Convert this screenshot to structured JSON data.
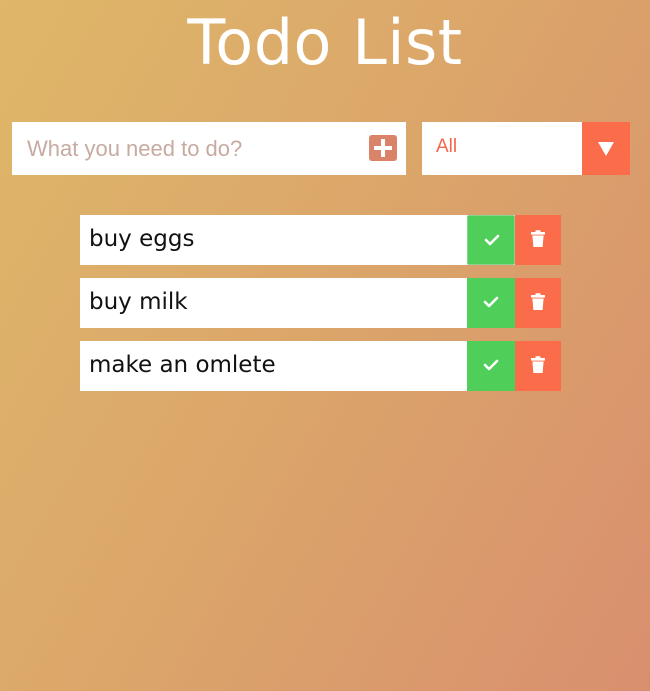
{
  "header": {
    "title": "Todo List"
  },
  "form": {
    "input_placeholder": "What you need to do?",
    "input_value": "",
    "add_icon": "plus-icon"
  },
  "filter": {
    "selected": "All",
    "arrow_icon": "chevron-down-icon"
  },
  "todos": [
    {
      "text": "buy eggs"
    },
    {
      "text": "buy milk"
    },
    {
      "text": "make an omlete"
    }
  ],
  "colors": {
    "accent": "#fb6c4a",
    "complete": "#4fcf5a",
    "add_button": "#d98468",
    "background_start": "#dfb769",
    "background_end": "#d98f6e"
  },
  "icons": {
    "complete": "check-icon",
    "delete": "trash-icon"
  }
}
